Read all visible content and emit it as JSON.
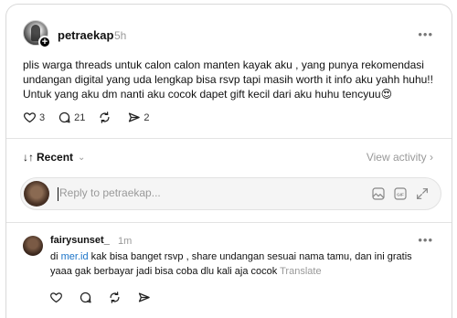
{
  "post": {
    "username": "petraekap",
    "time": "5h",
    "more_label": "•••",
    "plus_badge": "+",
    "text": "plis warga threads untuk calon calon manten kayak aku , yang punya rekomendasi undangan digital yang uda lengkap bisa rsvp tapi masih worth it info aku yahh huhu!! Untuk yang aku dm nanti aku cocok dapet gift kecil dari aku huhu tencyuu😍",
    "likes": "3",
    "replies": "21",
    "reposts": "",
    "shares": "2",
    "icons": [
      "heart-icon",
      "comment-icon",
      "repost-icon",
      "share-icon"
    ]
  },
  "sort": {
    "arrows": "↓↑",
    "label": "Recent",
    "chevron": "⌄",
    "view_activity": "View activity",
    "view_activity_chevron": "›"
  },
  "reply": {
    "placeholder": "Reply to petraekap...",
    "icons": [
      "image-icon",
      "gif-icon",
      "expand-icon"
    ]
  },
  "comment": {
    "username": "fairysunset_",
    "time": "1m",
    "more_label": "•••",
    "text_prefix": "di ",
    "mention": "mer.id",
    "text_body": " kak bisa banget rsvp , share undangan sesuai nama tamu, dan ini gratis yaaa gak berbayar jadi bisa coba dlu kali aja cocok",
    "translate": "Translate",
    "icons": [
      "heart-icon",
      "comment-icon",
      "repost-icon",
      "share-icon"
    ]
  },
  "colors": {
    "accent_link": "#1a73c8",
    "muted": "#999999",
    "border": "#d9d9d9"
  }
}
